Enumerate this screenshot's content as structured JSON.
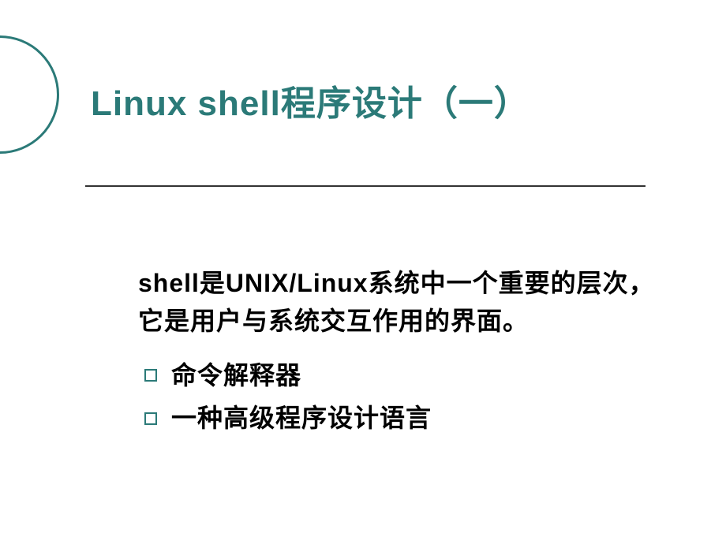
{
  "slide": {
    "title": "Linux shell程序设计（一）",
    "description": "shell是UNIX/Linux系统中一个重要的层次，它是用户与系统交互作用的界面。",
    "bullets": [
      "命令解释器",
      "一种高级程序设计语言"
    ]
  }
}
